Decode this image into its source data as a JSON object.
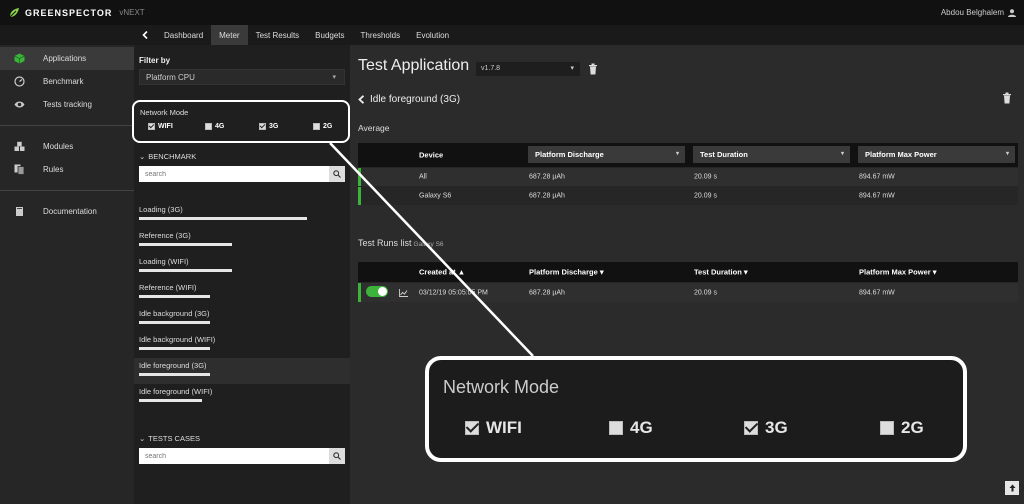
{
  "brand": {
    "name": "GREENSPECTOR",
    "version": "vNEXT"
  },
  "user": {
    "name": "Abdou Belghalem"
  },
  "sidebar": {
    "items": [
      {
        "label": "Applications",
        "icon": "cube-icon",
        "active": true
      },
      {
        "label": "Benchmark",
        "icon": "gauge-icon"
      },
      {
        "label": "Tests tracking",
        "icon": "eye-icon"
      },
      {
        "label": "Modules",
        "icon": "cubes-icon"
      },
      {
        "label": "Rules",
        "icon": "copy-icon"
      },
      {
        "label": "Documentation",
        "icon": "book-icon"
      }
    ]
  },
  "tabs": [
    "Dashboard",
    "Meter",
    "Test Results",
    "Budgets",
    "Thresholds",
    "Evolution"
  ],
  "active_tab": "Meter",
  "filter": {
    "title": "Filter by",
    "selected": "Platform CPU",
    "network_mode": {
      "title": "Network Mode",
      "options": [
        {
          "label": "WIFI",
          "checked": true
        },
        {
          "label": "4G",
          "checked": false
        },
        {
          "label": "3G",
          "checked": true
        },
        {
          "label": "2G",
          "checked": false
        }
      ]
    },
    "benchmark_header": "BENCHMARK",
    "benchmark_search_placeholder": "search",
    "benchmark_items": [
      {
        "label": "Loading (3G)",
        "level": 0.78
      },
      {
        "label": "Reference (3G)",
        "level": 0.43
      },
      {
        "label": "Loading (WIFI)",
        "level": 0.43
      },
      {
        "label": "Reference (WIFI)",
        "level": 0.33
      },
      {
        "label": "Idle background (3G)",
        "level": 0.33
      },
      {
        "label": "Idle background (WIFI)",
        "level": 0.33
      },
      {
        "label": "Idle foreground (3G)",
        "level": 0.33,
        "active": true
      },
      {
        "label": "Idle foreground (WIFI)",
        "level": 0.29
      }
    ],
    "tests_header": "TESTS CASES",
    "tests_search_placeholder": "search"
  },
  "main": {
    "app_title": "Test Application",
    "version": "v1.7.8",
    "subtitle": "Idle foreground (3G)",
    "average_label": "Average",
    "avg_table": {
      "headers": [
        "Device",
        "Platform Discharge",
        "Test Duration",
        "Platform Max Power"
      ],
      "rows": [
        [
          "All",
          "687.28 µAh",
          "20.09 s",
          "894.67 mW"
        ],
        [
          "Galaxy S6",
          "687.28 µAh",
          "20.09 s",
          "894.67 mW"
        ]
      ]
    },
    "runs_title": "Test Runs list",
    "runs_device": "Galaxy S6",
    "runs_table": {
      "headers": [
        "Created at ▲",
        "Platform Discharge ▾",
        "Test Duration ▾",
        "Platform Max Power ▾"
      ],
      "rows": [
        [
          "03/12/19 05:05:05 PM",
          "687.28 µAh",
          "20.09 s",
          "894.67 mW"
        ]
      ]
    }
  },
  "zoom": {
    "title": "Network Mode",
    "options": [
      {
        "label": "WIFI",
        "checked": true
      },
      {
        "label": "4G",
        "checked": false
      },
      {
        "label": "3G",
        "checked": true
      },
      {
        "label": "2G",
        "checked": false
      }
    ]
  },
  "colors": {
    "accent": "#3cb43c"
  }
}
